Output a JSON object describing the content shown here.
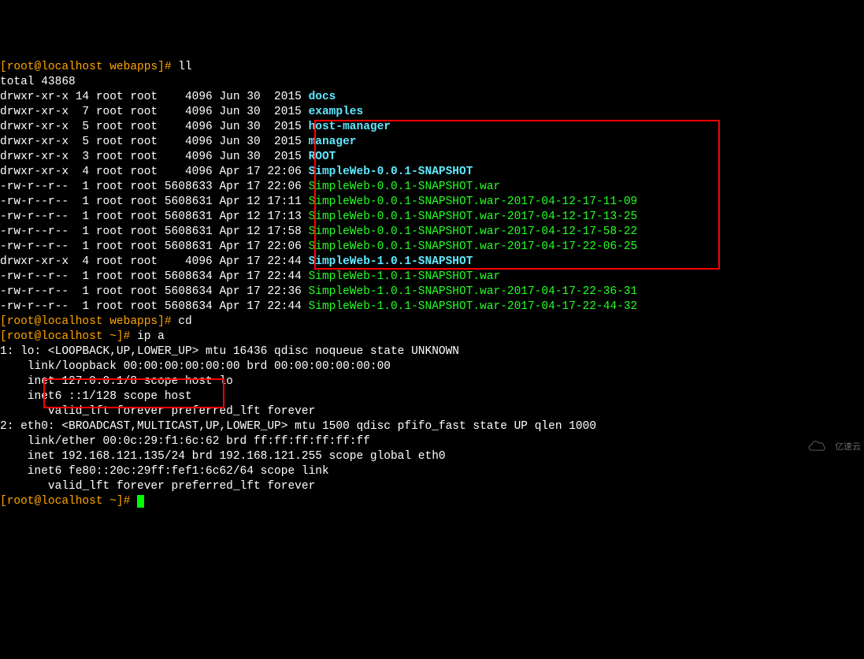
{
  "lines": [
    {
      "segments": [
        {
          "cls": "prompt-orange",
          "t": "[root@localhost webapps]# "
        },
        {
          "cls": "white",
          "t": "ll"
        }
      ]
    },
    {
      "segments": [
        {
          "cls": "white",
          "t": "total 43868"
        }
      ]
    },
    {
      "segments": [
        {
          "cls": "white",
          "t": "drwxr-xr-x 14 root root    4096 Jun 30  2015 "
        },
        {
          "cls": "cyan-bold",
          "t": "docs"
        }
      ]
    },
    {
      "segments": [
        {
          "cls": "white",
          "t": "drwxr-xr-x  7 root root    4096 Jun 30  2015 "
        },
        {
          "cls": "cyan-bold",
          "t": "examples"
        }
      ]
    },
    {
      "segments": [
        {
          "cls": "white",
          "t": "drwxr-xr-x  5 root root    4096 Jun 30  2015 "
        },
        {
          "cls": "cyan-bold",
          "t": "host-manager"
        }
      ]
    },
    {
      "segments": [
        {
          "cls": "white",
          "t": "drwxr-xr-x  5 root root    4096 Jun 30  2015 "
        },
        {
          "cls": "cyan-bold",
          "t": "manager"
        }
      ]
    },
    {
      "segments": [
        {
          "cls": "white",
          "t": "drwxr-xr-x  3 root root    4096 Jun 30  2015 "
        },
        {
          "cls": "cyan-bold",
          "t": "ROOT"
        }
      ]
    },
    {
      "segments": [
        {
          "cls": "white",
          "t": "drwxr-xr-x  4 root root    4096 Apr 17 22:06 "
        },
        {
          "cls": "cyan-bold",
          "t": "SimpleWeb-0.0.1-SNAPSHOT"
        }
      ]
    },
    {
      "segments": [
        {
          "cls": "white",
          "t": "-rw-r--r--  1 root root 5608633 Apr 17 22:06 "
        },
        {
          "cls": "green",
          "t": "SimpleWeb-0.0.1-SNAPSHOT.war"
        }
      ]
    },
    {
      "segments": [
        {
          "cls": "white",
          "t": "-rw-r--r--  1 root root 5608631 Apr 12 17:11 "
        },
        {
          "cls": "green",
          "t": "SimpleWeb-0.0.1-SNAPSHOT.war-2017-04-12-17-11-09"
        }
      ]
    },
    {
      "segments": [
        {
          "cls": "white",
          "t": "-rw-r--r--  1 root root 5608631 Apr 12 17:13 "
        },
        {
          "cls": "green",
          "t": "SimpleWeb-0.0.1-SNAPSHOT.war-2017-04-12-17-13-25"
        }
      ]
    },
    {
      "segments": [
        {
          "cls": "white",
          "t": "-rw-r--r--  1 root root 5608631 Apr 12 17:58 "
        },
        {
          "cls": "green",
          "t": "SimpleWeb-0.0.1-SNAPSHOT.war-2017-04-12-17-58-22"
        }
      ]
    },
    {
      "segments": [
        {
          "cls": "white",
          "t": "-rw-r--r--  1 root root 5608631 Apr 17 22:06 "
        },
        {
          "cls": "green",
          "t": "SimpleWeb-0.0.1-SNAPSHOT.war-2017-04-17-22-06-25"
        }
      ]
    },
    {
      "segments": [
        {
          "cls": "white",
          "t": "drwxr-xr-x  4 root root    4096 Apr 17 22:44 "
        },
        {
          "cls": "cyan-bold",
          "t": "SimpleWeb-1.0.1-SNAPSHOT"
        }
      ]
    },
    {
      "segments": [
        {
          "cls": "white",
          "t": "-rw-r--r--  1 root root 5608634 Apr 17 22:44 "
        },
        {
          "cls": "green",
          "t": "SimpleWeb-1.0.1-SNAPSHOT.war"
        }
      ]
    },
    {
      "segments": [
        {
          "cls": "white",
          "t": "-rw-r--r--  1 root root 5608634 Apr 17 22:36 "
        },
        {
          "cls": "green",
          "t": "SimpleWeb-1.0.1-SNAPSHOT.war-2017-04-17-22-36-31"
        }
      ]
    },
    {
      "segments": [
        {
          "cls": "white",
          "t": "-rw-r--r--  1 root root 5608634 Apr 17 22:44 "
        },
        {
          "cls": "green",
          "t": "SimpleWeb-1.0.1-SNAPSHOT.war-2017-04-17-22-44-32"
        }
      ]
    },
    {
      "segments": [
        {
          "cls": "prompt-orange",
          "t": "[root@localhost webapps]# "
        },
        {
          "cls": "white",
          "t": "cd"
        }
      ]
    },
    {
      "segments": [
        {
          "cls": "prompt-orange",
          "t": "[root@localhost ~]# "
        },
        {
          "cls": "white",
          "t": "ip a"
        }
      ]
    },
    {
      "segments": [
        {
          "cls": "white",
          "t": "1: lo: <LOOPBACK,UP,LOWER_UP> mtu 16436 qdisc noqueue state UNKNOWN "
        }
      ]
    },
    {
      "segments": [
        {
          "cls": "white",
          "t": "    link/loopback 00:00:00:00:00:00 brd 00:00:00:00:00:00"
        }
      ]
    },
    {
      "segments": [
        {
          "cls": "white",
          "t": "    inet 127.0.0.1/8 scope host lo"
        }
      ]
    },
    {
      "segments": [
        {
          "cls": "white",
          "t": "    inet6 ::1/128 scope host "
        }
      ]
    },
    {
      "segments": [
        {
          "cls": "white",
          "t": "       valid_lft forever preferred_lft forever"
        }
      ]
    },
    {
      "segments": [
        {
          "cls": "white",
          "t": "2: eth0: <BROADCAST,MULTICAST,UP,LOWER_UP> mtu 1500 qdisc pfifo_fast state UP qlen 1000"
        }
      ]
    },
    {
      "segments": [
        {
          "cls": "white",
          "t": "    link/ether 00:0c:29:f1:6c:62 brd ff:ff:ff:ff:ff:ff"
        }
      ]
    },
    {
      "segments": [
        {
          "cls": "white",
          "t": "    inet 192.168.121.135/24 brd 192.168.121.255 scope global eth0"
        }
      ]
    },
    {
      "segments": [
        {
          "cls": "white",
          "t": "    inet6 fe80::20c:29ff:fef1:6c62/64 scope link "
        }
      ]
    },
    {
      "segments": [
        {
          "cls": "white",
          "t": "       valid_lft forever preferred_lft forever"
        }
      ]
    },
    {
      "segments": [
        {
          "cls": "prompt-orange",
          "t": "[root@localhost ~]# "
        }
      ],
      "cursor": true
    }
  ],
  "watermark_text": "亿速云"
}
